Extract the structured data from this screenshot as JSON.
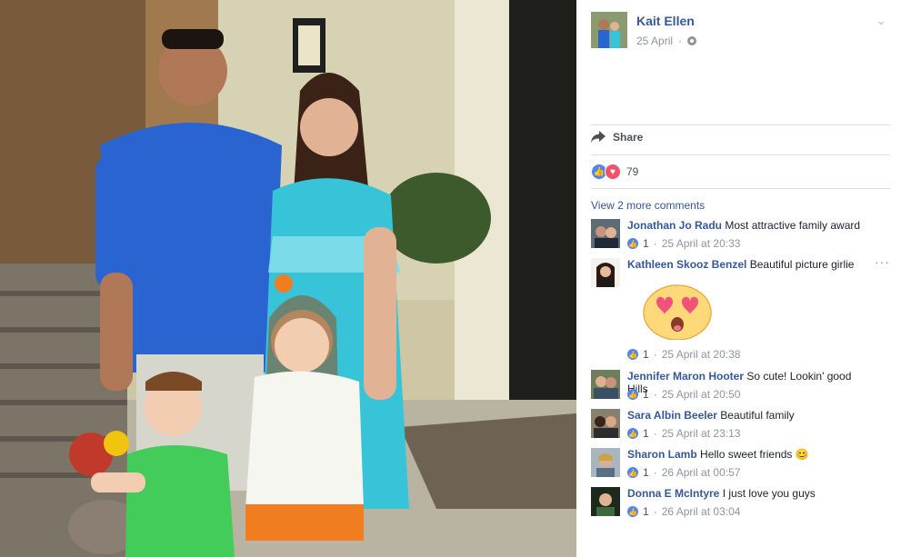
{
  "post": {
    "author": "Kait Ellen",
    "date": "25 April",
    "share_label": "Share",
    "reaction_count": "79",
    "view_more_comments": "View 2 more comments"
  },
  "comments": [
    {
      "name": "Jonathan Jo Radu",
      "text": "Most attractive family award",
      "likes": "1",
      "time": "25 April at 20:33"
    },
    {
      "name": "Kathleen Skooz Benzel",
      "text": "Beautiful picture girlie",
      "likes": "1",
      "time": "25 April at 20:38"
    },
    {
      "name": "Jennifer Maron Hooter",
      "text": "So cute! Lookin' good Hills",
      "likes": "1",
      "time": "25 April at 20:50"
    },
    {
      "name": "Sara Albin Beeler",
      "text": "Beautiful family",
      "likes": "1",
      "time": "25 April at 23:13"
    },
    {
      "name": "Sharon Lamb",
      "text": "Hello sweet friends 😊",
      "likes": "1",
      "time": "26 April at 00:57"
    },
    {
      "name": "Donna E McIntyre",
      "text": "I just love you guys",
      "likes": "1",
      "time": "26 April at 03:04"
    }
  ],
  "icons": {
    "share": "share-arrow-icon",
    "like": "like-reaction-icon",
    "love": "love-reaction-icon",
    "privacy": "globe-icon",
    "options": "chevron-down-icon",
    "comment_options": "more-dots-icon"
  },
  "colors": {
    "link": "#365899",
    "meta": "#90949c",
    "like_blue": "#4f84f7",
    "love_red": "#f25268"
  }
}
